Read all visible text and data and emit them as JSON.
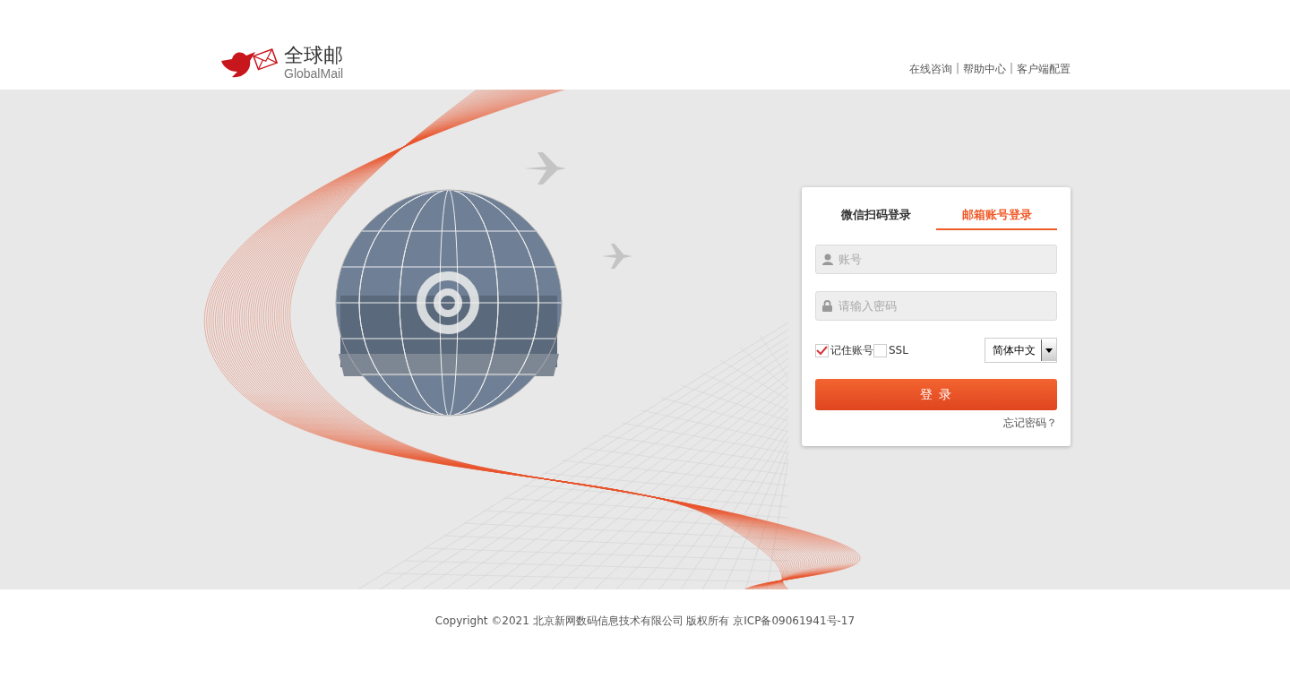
{
  "logo": {
    "name": "全球邮",
    "subtitle": "GlobalMail"
  },
  "header_links": [
    {
      "kind": "link",
      "label": "在线咨询"
    },
    {
      "kind": "separator",
      "label": "|"
    },
    {
      "kind": "link",
      "label": "帮助中心"
    },
    {
      "kind": "separator",
      "label": "|"
    },
    {
      "kind": "link",
      "label": "客户端配置"
    }
  ],
  "login": {
    "tabs": [
      {
        "label": "微信扫码登录",
        "selected": false
      },
      {
        "label": "邮箱账号登录",
        "selected": true
      }
    ],
    "account_field": {
      "placeholder": "账号"
    },
    "password_field": {
      "placeholder": "请输入密码"
    },
    "options": [
      {
        "label": "记住账号",
        "checked": true
      },
      {
        "label": "SSL",
        "checked": false
      }
    ],
    "language": "简体中文",
    "submit": "登 录",
    "forgot_link": "忘记密码？"
  },
  "footer": "Copyright ©2021 北京新网数码信息技术有限公司 版权所有 京ICP备09061941号-17"
}
